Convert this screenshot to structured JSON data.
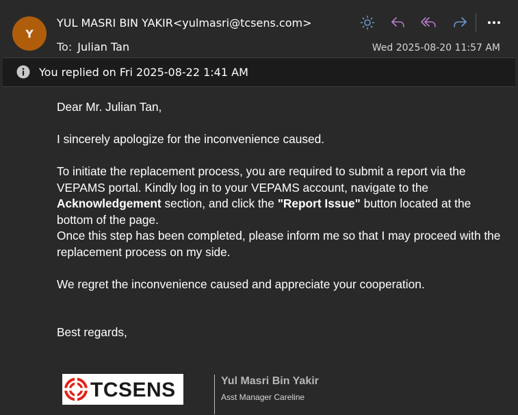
{
  "header": {
    "avatar_initial": "Y",
    "sender": "YUL MASRI BIN YAKIR<yulmasri@tcsens.com>",
    "to_label": "To:",
    "to_value": "Julian Tan",
    "date": "Wed 2025-08-20 11:57 AM",
    "actions": [
      {
        "name": "brightness-icon",
        "color": "#6c9ad0"
      },
      {
        "name": "reply-icon",
        "color": "#b77ec8"
      },
      {
        "name": "reply-all-icon",
        "color": "#b77ec8"
      },
      {
        "name": "forward-icon",
        "color": "#6c9ad0"
      },
      {
        "name": "more-icon",
        "color": "#ffffff"
      }
    ]
  },
  "info_bar": {
    "icon": "info-icon",
    "text": "You replied on Fri 2025-08-22 1:41 AM"
  },
  "message": {
    "greeting": "Dear Mr. Julian Tan,",
    "apology": "I sincerely apologize for the inconvenience caused.",
    "p3_a": "To initiate the replacement process, you are required to submit a report via the VEPAMS portal. Kindly log in to your VEPAMS account, navigate to the ",
    "p3_bold1": "Acknowledgement",
    "p3_b": " section, and click the ",
    "p3_bold2": "\"Report Issue\"",
    "p3_c": " button located at the bottom of the page.",
    "p4": "Once this step has been completed, please inform me so that I may proceed with the replacement process on my side.",
    "p5": "We regret the inconvenience caused and appreciate your cooperation.",
    "closing": "Best regards,"
  },
  "signature": {
    "logo_text": "TCSENS",
    "name": "Yul Masri Bin Yakir",
    "title": "Asst Manager Careline"
  }
}
